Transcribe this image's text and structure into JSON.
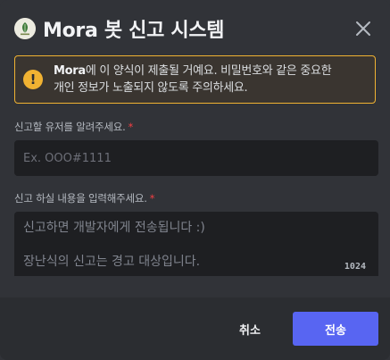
{
  "modal": {
    "title": "Mora 봇 신고 시스템",
    "logo_icon": "leaf-logo-icon",
    "close_icon": "close-icon"
  },
  "warning": {
    "icon": "exclamation-icon",
    "bold_text": "Mora",
    "text_line1": "에 이 양식이 제출될 거예요. 비밀번호와 같은 중요한",
    "text_line2": "개인 정보가 노출되지 않도록 주의하세요.",
    "border_color": "#f0b232"
  },
  "form": {
    "user_label": "신고할 유저를 알려주세요.",
    "user_required": "*",
    "user_placeholder": "Ex. OOO#1111",
    "user_value": "",
    "content_label": "신고 하실 내용을 입력해주세요.",
    "content_required": "*",
    "content_placeholder": "신고하면 개발자에게 전송됩니다 :)\n\n장난식의 신고는 경고 대상입니다.",
    "content_value": "",
    "char_counter": "1024"
  },
  "footer": {
    "cancel_label": "취소",
    "submit_label": "전송",
    "submit_color": "#5865f2"
  }
}
